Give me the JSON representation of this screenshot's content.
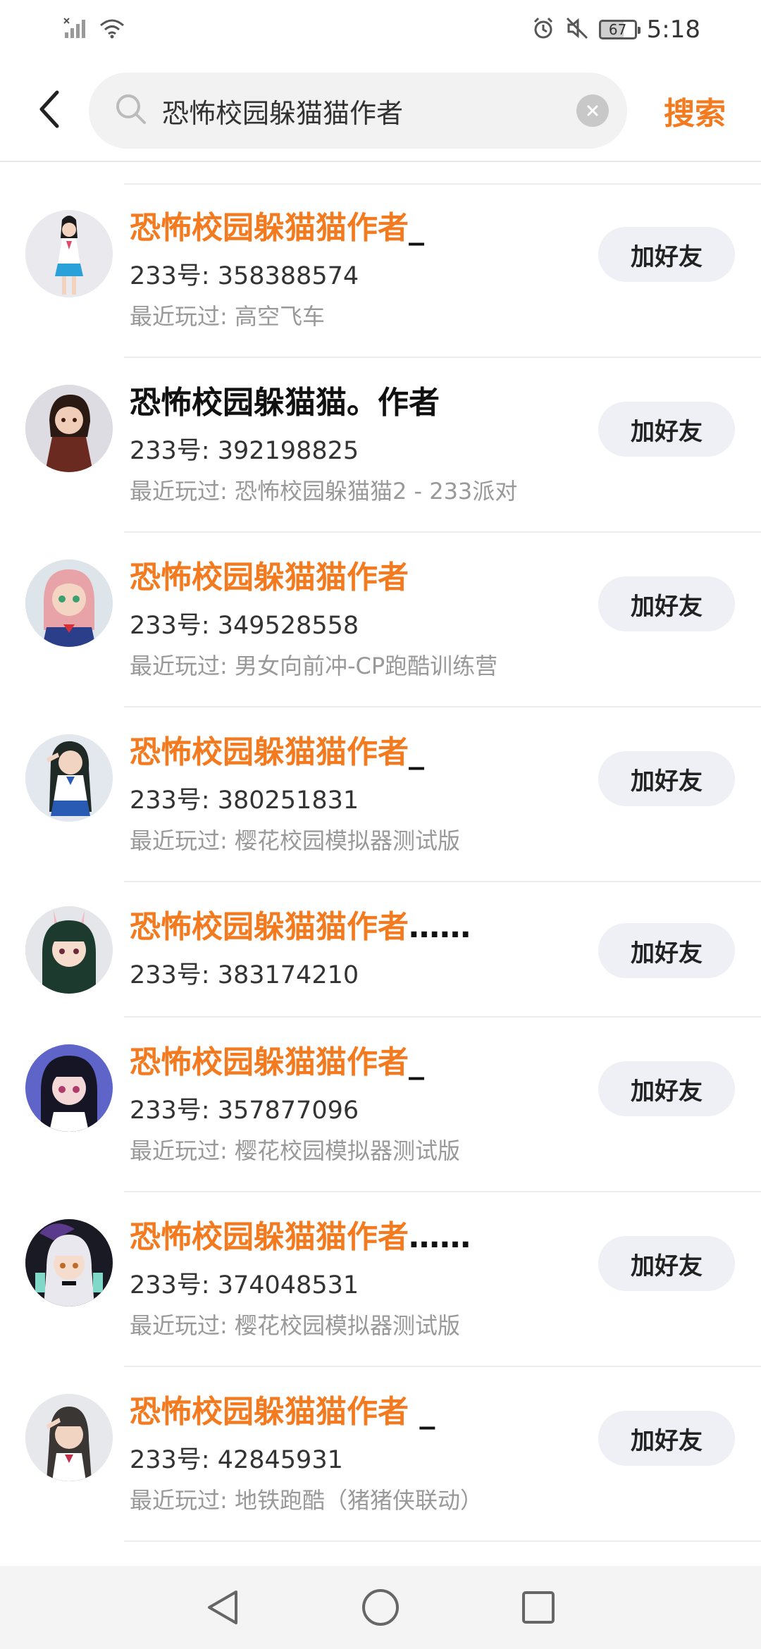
{
  "status_bar": {
    "battery": "67",
    "time": "5:18"
  },
  "search": {
    "query": "恐怖校园躲猫猫作者",
    "submit_label": "搜索"
  },
  "results": [
    {
      "name_highlight": "恐怖校园躲猫猫作者",
      "name_rest": "_",
      "id": "233号: 358388574",
      "recent": "最近玩过: 高空飞车",
      "button": "加好友"
    },
    {
      "name_highlight": "",
      "name_rest": "恐怖校园躲猫猫。作者",
      "id": "233号: 392198825",
      "recent": "最近玩过: 恐怖校园躲猫猫2 - 233派对",
      "button": "加好友"
    },
    {
      "name_highlight": "恐怖校园躲猫猫作者",
      "name_rest": "",
      "id": "233号: 349528558",
      "recent": "最近玩过: 男女向前冲-CP跑酷训练营",
      "button": "加好友"
    },
    {
      "name_highlight": "恐怖校园躲猫猫作者",
      "name_rest": "_",
      "id": "233号: 380251831",
      "recent": "最近玩过: 樱花校园模拟器测试版",
      "button": "加好友"
    },
    {
      "name_highlight": "恐怖校园躲猫猫作者",
      "name_rest": "……",
      "id": "233号: 383174210",
      "recent": "",
      "button": "加好友"
    },
    {
      "name_highlight": "恐怖校园躲猫猫作者",
      "name_rest": "_",
      "id": "233号: 357877096",
      "recent": "最近玩过: 樱花校园模拟器测试版",
      "button": "加好友"
    },
    {
      "name_highlight": "恐怖校园躲猫猫作者",
      "name_rest": "……",
      "id": "233号: 374048531",
      "recent": "最近玩过: 樱花校园模拟器测试版",
      "button": "加好友"
    },
    {
      "name_highlight": "恐怖校园躲猫猫作者",
      "name_rest": " _",
      "id": "233号: 42845931",
      "recent": "最近玩过: 地铁跑酷（猪猪侠联动）",
      "button": "加好友"
    }
  ],
  "colors": {
    "accent": "#f37a1f",
    "button_bg": "#eef0f5"
  },
  "icons": {
    "back": "chevron-left-icon",
    "search": "magnifier-icon",
    "clear": "clear-icon",
    "nav_back": "triangle-back-icon",
    "nav_home": "circle-home-icon",
    "nav_recent": "square-recent-icon"
  }
}
